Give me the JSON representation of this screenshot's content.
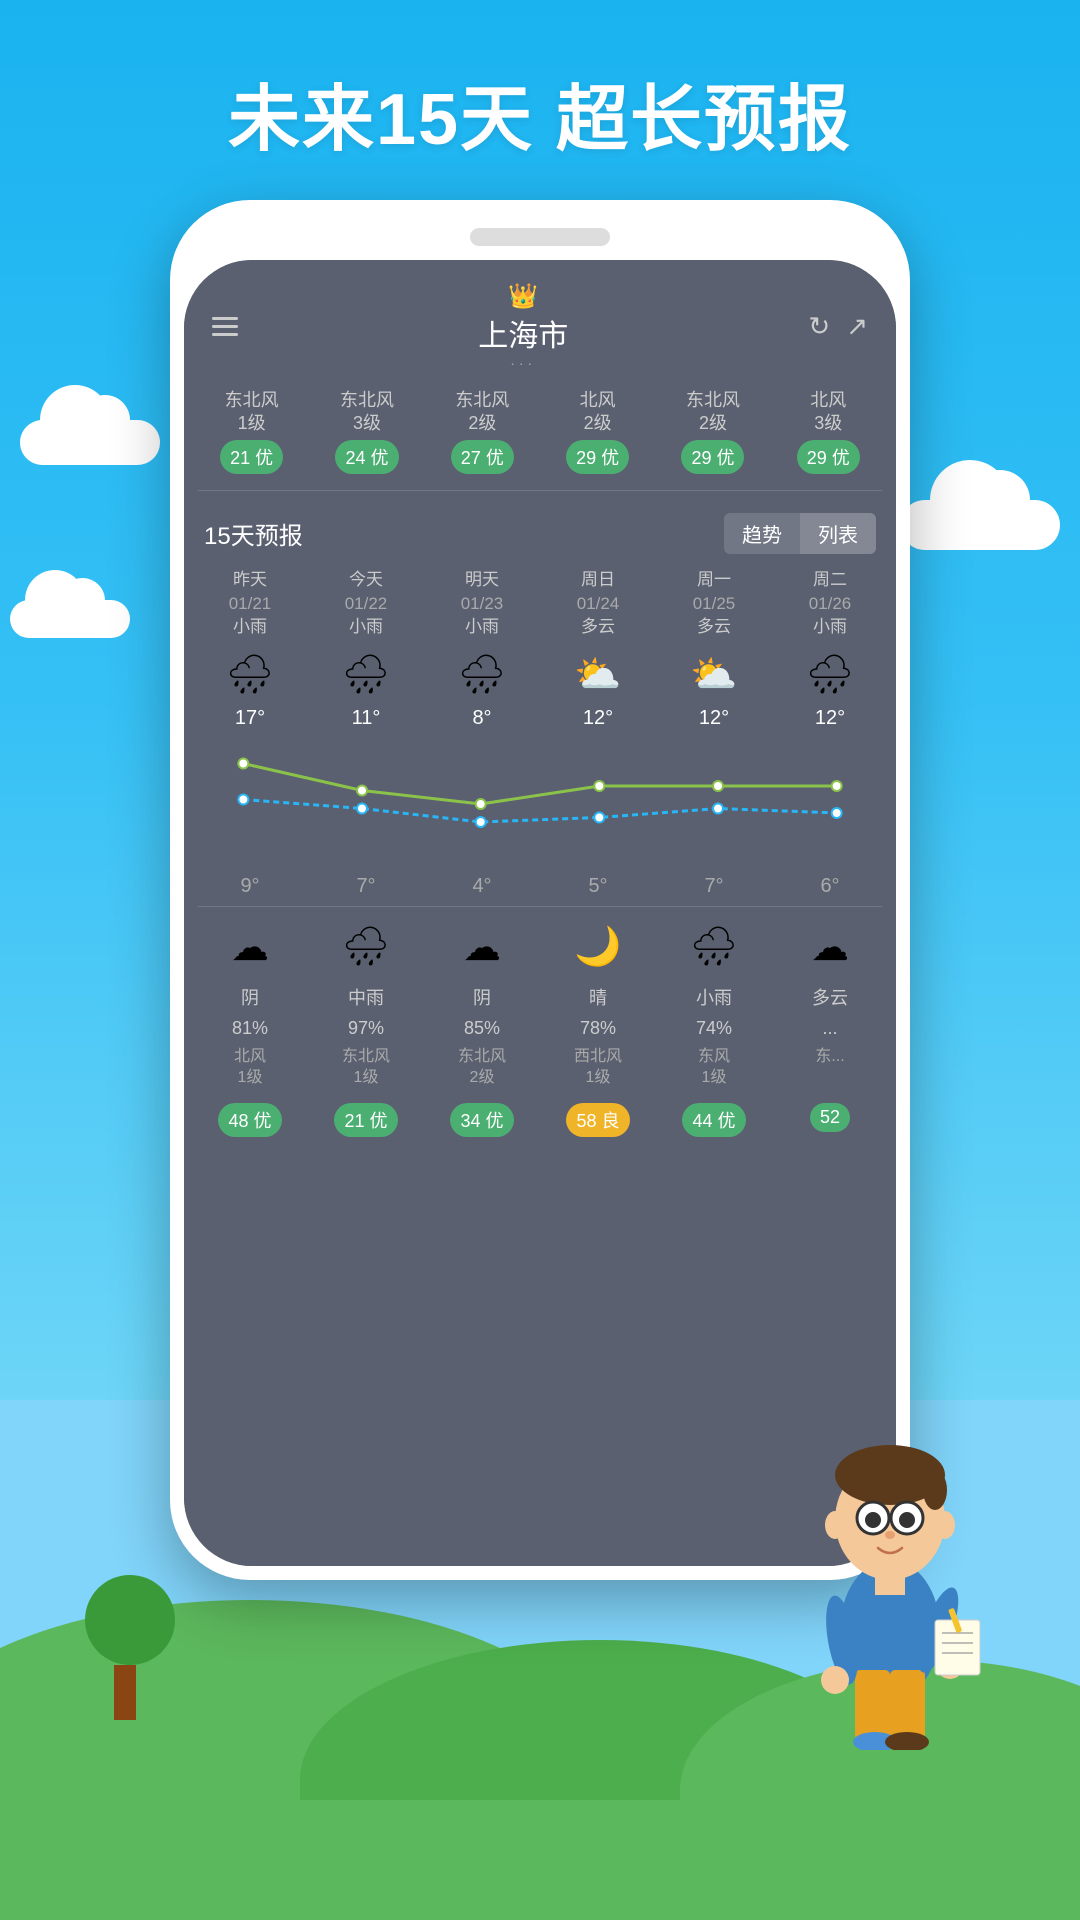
{
  "title": "未来15天 超长预报",
  "background": {
    "sky_color_top": "#1ab3f0",
    "sky_color_bottom": "#6dd5f7",
    "hill_color": "#5cb85c"
  },
  "phone": {
    "city": "上海市",
    "city_dots": "···",
    "hourly": [
      {
        "wind": "东北风\n1级",
        "aqi": "21 优",
        "type": "good"
      },
      {
        "wind": "东北风\n3级",
        "aqi": "24 优",
        "type": "good"
      },
      {
        "wind": "东北风\n2级",
        "aqi": "27 优",
        "type": "good"
      },
      {
        "wind": "北风\n2级",
        "aqi": "29 优",
        "type": "good"
      },
      {
        "wind": "东北风\n2级",
        "aqi": "29 优",
        "type": "good"
      },
      {
        "wind": "北风\n3级",
        "aqi": "29 优",
        "type": "good"
      }
    ],
    "forecast_label": "15天预报",
    "tab_trend": "趋势",
    "tab_list": "列表",
    "days": [
      {
        "label": "昨天",
        "date": "01/21",
        "condition": "小雨",
        "icon": "🌧",
        "high": "17°",
        "low": "9°",
        "night_icon": "☁",
        "night_cond": "阴",
        "percent": "81%",
        "wind": "北风\n1级",
        "aqi": "48 优",
        "aqi_type": "good"
      },
      {
        "label": "今天",
        "date": "01/22",
        "condition": "小雨",
        "icon": "🌧",
        "high": "11°",
        "low": "7°",
        "night_icon": "🌧",
        "night_cond": "中雨",
        "percent": "97%",
        "wind": "东北风\n1级",
        "aqi": "21 优",
        "aqi_type": "good"
      },
      {
        "label": "明天",
        "date": "01/23",
        "condition": "小雨",
        "icon": "🌧",
        "high": "8°",
        "low": "4°",
        "night_icon": "☁",
        "night_cond": "阴",
        "percent": "85%",
        "wind": "东北风\n2级",
        "aqi": "34 优",
        "aqi_type": "good"
      },
      {
        "label": "周日",
        "date": "01/24",
        "condition": "多云",
        "icon": "⛅",
        "high": "12°",
        "low": "5°",
        "night_icon": "🌙",
        "night_cond": "晴",
        "percent": "78%",
        "wind": "西北风\n1级",
        "aqi": "58 良",
        "aqi_type": "fair"
      },
      {
        "label": "周一",
        "date": "01/25",
        "condition": "多云",
        "icon": "⛅",
        "high": "12°",
        "low": "7°",
        "night_icon": "🌧",
        "night_cond": "小雨",
        "percent": "74%",
        "wind": "东风\n1级",
        "aqi": "44 优",
        "aqi_type": "good"
      },
      {
        "label": "周二",
        "date": "01/26",
        "condition": "小雨",
        "icon": "🌧",
        "high": "12°",
        "low": "6°",
        "night_icon": "☁",
        "night_cond": "多云",
        "percent": "...",
        "wind": "东...",
        "aqi": "52",
        "aqi_type": "good"
      }
    ]
  }
}
